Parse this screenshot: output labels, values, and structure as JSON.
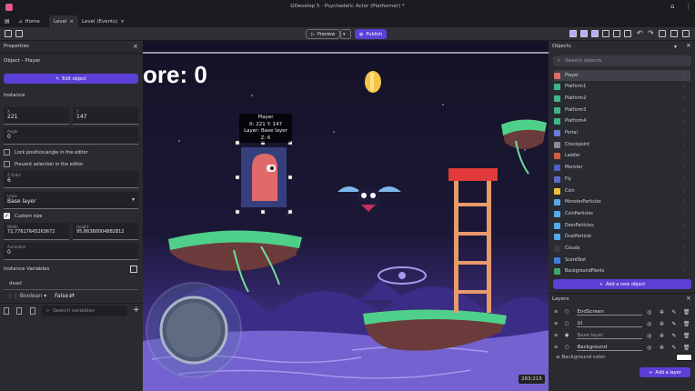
{
  "titlebar": {
    "title": "GDevelop 5 - Psychedelic Actor (Platformer) *"
  },
  "tabs": [
    {
      "label": "Home"
    },
    {
      "label": "Level"
    },
    {
      "label": "Level (Events)"
    }
  ],
  "toolbar": {
    "preview": "Preview",
    "publish": "Publish"
  },
  "properties": {
    "title": "Properties",
    "object_label": "Object  - Player",
    "edit_button": "Edit object",
    "instance_heading": "Instance",
    "x": {
      "label": "X",
      "value": "221"
    },
    "y": {
      "label": "Y",
      "value": "147"
    },
    "angle": {
      "label": "Angle",
      "value": "0"
    },
    "lock": "Lock position/angle in the editor",
    "prevent": "Prevent selection in the editor",
    "z": {
      "label": "Z Order",
      "value": "6"
    },
    "layer": {
      "label": "Layer",
      "value": "Base layer"
    },
    "custom_size": "Custom size",
    "width": {
      "label": "Width",
      "value": "72,77617645263672"
    },
    "height": {
      "label": "Height",
      "value": "95,66380004882812"
    },
    "animation": {
      "label": "Animation",
      "value": "0"
    },
    "vars_heading": "Instance Variables",
    "var_name": "dead",
    "var_type": "Boolean",
    "var_value": "False",
    "search_vars_placeholder": "Search variables"
  },
  "scene": {
    "score": "ore: 0",
    "tooltip": {
      "l1": "Player",
      "l2": "X: 221  Y: 147",
      "l3": "Layer: Base layer",
      "l4": "Z: 6"
    },
    "coords": "283;215"
  },
  "objects": {
    "title": "Objects",
    "search_placeholder": "Search objects",
    "items": [
      {
        "name": "Player",
        "color": "#e06a6a"
      },
      {
        "name": "Platform1",
        "color": "#3fb58a"
      },
      {
        "name": "Platform2",
        "color": "#3fb58a"
      },
      {
        "name": "Platform3",
        "color": "#3fb58a"
      },
      {
        "name": "Platform4",
        "color": "#3fb58a"
      },
      {
        "name": "Portal",
        "color": "#6c7ad8"
      },
      {
        "name": "Checkpoint",
        "color": "#8a8a94"
      },
      {
        "name": "Ladder",
        "color": "#d95a3e"
      },
      {
        "name": "Monster",
        "color": "#4b5fc8"
      },
      {
        "name": "Fly",
        "color": "#5b6cd0"
      },
      {
        "name": "Coin",
        "color": "#f0c23a"
      },
      {
        "name": "MonsterParticles",
        "color": "#57a9e8"
      },
      {
        "name": "CoinParticles",
        "color": "#57a9e8"
      },
      {
        "name": "DoorParticles",
        "color": "#57a9e8"
      },
      {
        "name": "DustParticle",
        "color": "#57a9e8"
      },
      {
        "name": "Clouds",
        "color": "#3a3b42"
      },
      {
        "name": "ScoreText",
        "color": "#3d7fe0"
      },
      {
        "name": "BackgroundPlants",
        "color": "#3fa86a"
      }
    ],
    "add_button": "Add a new object"
  },
  "layers": {
    "title": "Layers",
    "items": [
      {
        "name": "EndScreen"
      },
      {
        "name": "UI"
      },
      {
        "name": "Base layer"
      },
      {
        "name": "Background"
      }
    ],
    "bg_label": "Background color",
    "add_button": "Add a layer"
  }
}
